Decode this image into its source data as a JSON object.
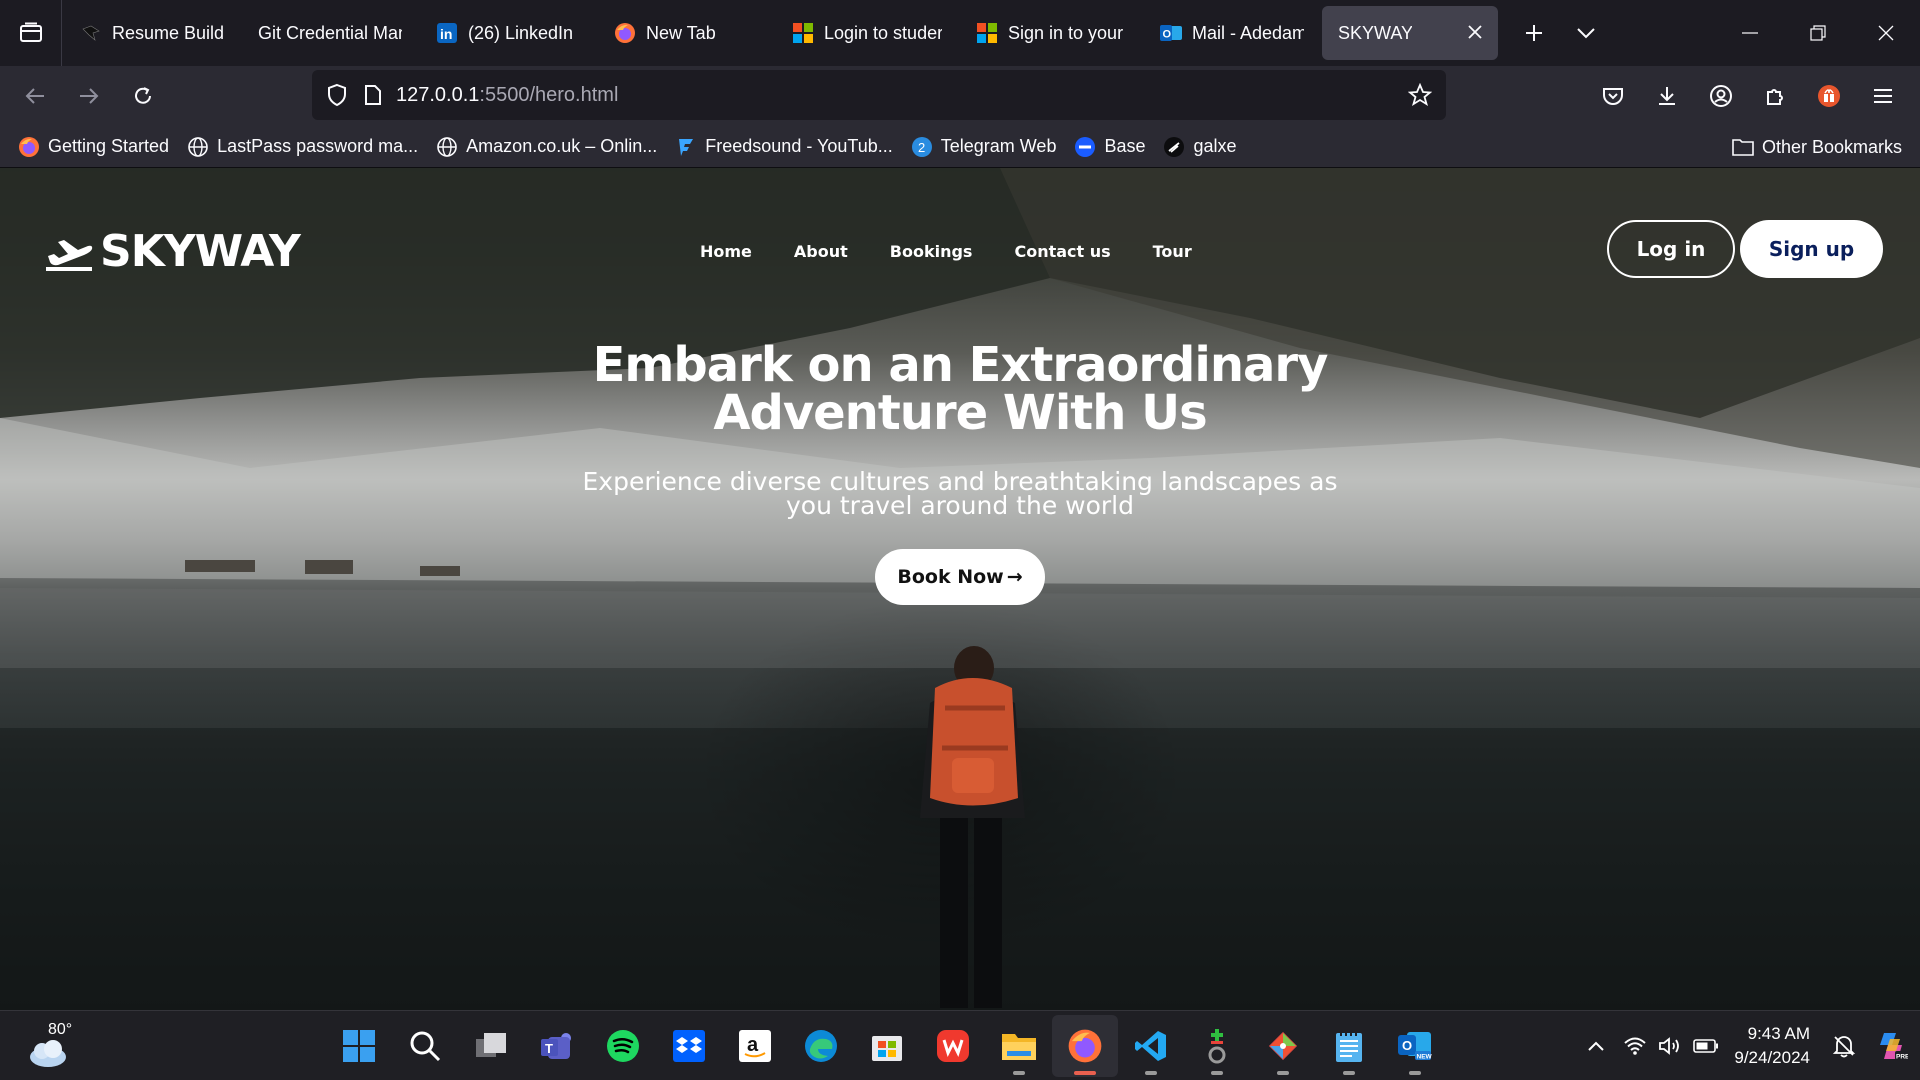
{
  "browser": {
    "tabs": [
      {
        "title": "Resume Builde",
        "icon": "bird-icon"
      },
      {
        "title": "Git Credential Man",
        "icon": "none"
      },
      {
        "title": "(26) LinkedIn",
        "icon": "linkedin-icon"
      },
      {
        "title": "New Tab",
        "icon": "firefox-icon"
      },
      {
        "title": "Login to studer",
        "icon": "microsoft-icon"
      },
      {
        "title": "Sign in to your",
        "icon": "microsoft-icon"
      },
      {
        "title": "Mail - Adedam",
        "icon": "outlook-icon"
      },
      {
        "title": "SKYWAY",
        "icon": "none",
        "active": true
      }
    ],
    "url": {
      "host": "127.0.0.1",
      "path": ":5500/hero.html"
    },
    "bookmarks": [
      {
        "label": "Getting Started",
        "icon": "firefox-icon"
      },
      {
        "label": "LastPass password ma...",
        "icon": "globe-icon"
      },
      {
        "label": "Amazon.co.uk – Onlin...",
        "icon": "globe-icon"
      },
      {
        "label": "Freedsound - YouTub...",
        "icon": "freedsound-icon"
      },
      {
        "label": "Telegram Web",
        "icon": "telegram-icon",
        "badge": "2"
      },
      {
        "label": "Base",
        "icon": "base-icon"
      },
      {
        "label": "galxe",
        "icon": "galxe-icon"
      }
    ],
    "other_bookmarks": "Other Bookmarks"
  },
  "page": {
    "logo": "SKYWAY",
    "nav": [
      "Home",
      "About",
      "Bookings",
      "Contact us",
      "Tour"
    ],
    "login": "Log in",
    "signup": "Sign up",
    "headline_line1": "Embark on an Extraordinary",
    "headline_line2": "Adventure With Us",
    "sub_line1": "Experience diverse cultures and breathtaking landscapes as",
    "sub_line2": "you travel around the world",
    "cta": "Book Now",
    "cta_arrow": "→"
  },
  "taskbar": {
    "temperature": "80°",
    "time": "9:43 AM",
    "date": "9/24/2024",
    "apps": [
      "windows-start-icon",
      "search-icon",
      "task-view-icon",
      "teams-icon",
      "spotify-icon",
      "dropbox-icon",
      "amazon-icon",
      "edge-icon",
      "store-icon",
      "wps-icon",
      "file-explorer-icon",
      "firefox-icon",
      "vscode-icon",
      "git-client-icon",
      "git-icon",
      "notepad-icon",
      "outlook-new-icon"
    ]
  }
}
